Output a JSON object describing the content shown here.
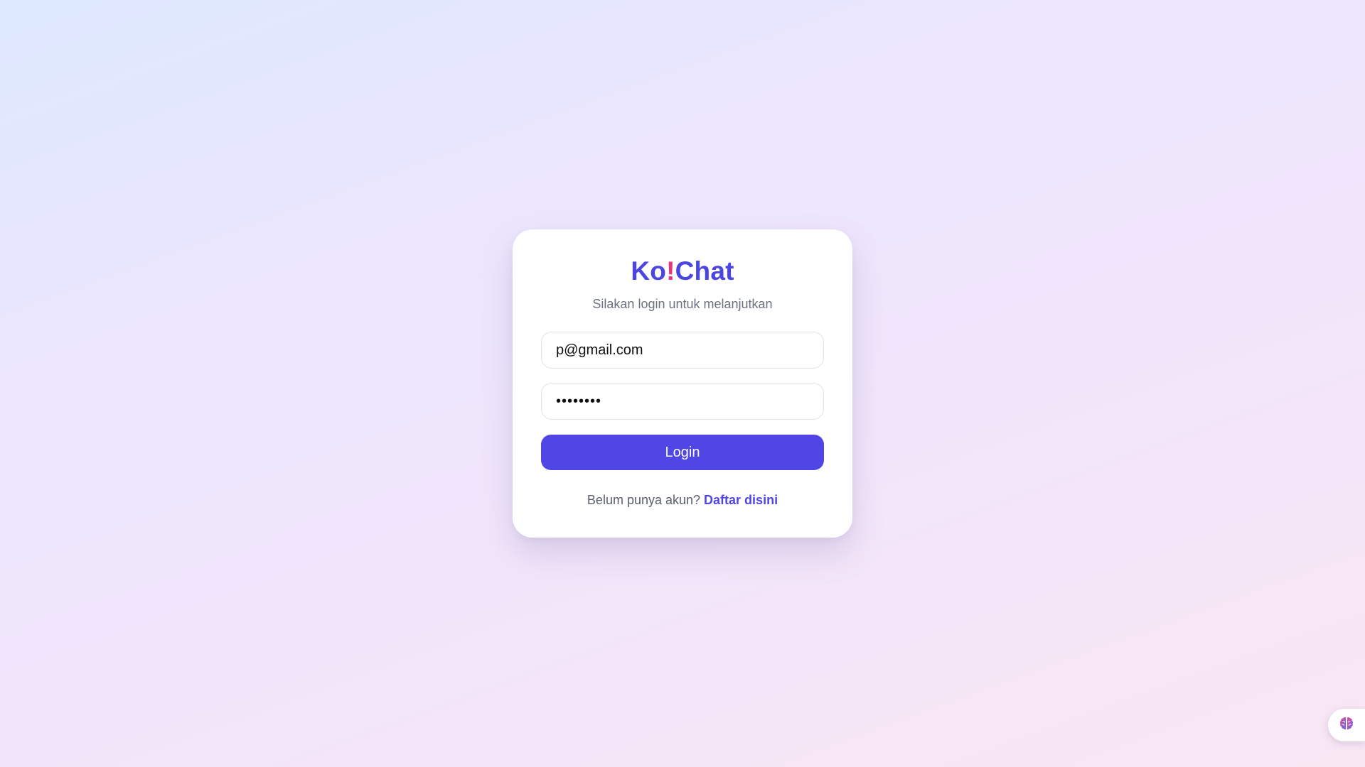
{
  "brand": {
    "prefix": "Ko",
    "bang": "!",
    "suffix": "Chat",
    "primary_color": "#4b45e2",
    "accent_color": "#e8357c"
  },
  "subtitle": "Silakan login untuk melanjutkan",
  "form": {
    "email_value": "p@gmail.com",
    "password_value": "••••••••",
    "login_label": "Login"
  },
  "footer": {
    "text": "Belum punya akun?",
    "link_label": "Daftar disini"
  },
  "widget": {
    "icon": "brain-icon"
  }
}
